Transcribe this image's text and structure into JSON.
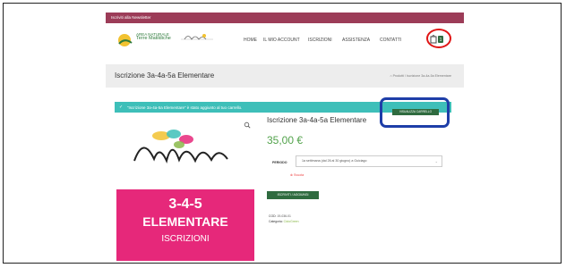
{
  "topbar": {
    "text": "Iscriviti alla Newsletter"
  },
  "header": {
    "logo_text_line1": "AREA NATURALE",
    "logo_text_line2": "Terre Matildiche",
    "logo2_alt": "ciclgreen logo",
    "nav": [
      "HOME",
      "IL MIO ACCOUNT",
      "ISCRIZIONI",
      "ASSISTENZA",
      "CONTATTI"
    ],
    "cart_count": "1"
  },
  "page": {
    "title": "Iscrizione 3a-4a-5a Elementare",
    "breadcrumb": "Prodotti  /  Iscrizione 3a-4a-5a Elementare"
  },
  "notice": {
    "check": "✓",
    "message": "“Iscrizione 3a-4a-5a Elementare” è stato aggiunto al tuo carrello.",
    "view_cart": "VISUALIZZA CARRELLO"
  },
  "product": {
    "image_text_1": "3-4-5",
    "image_text_2": "ELEMENTARE",
    "image_text_3": "ISCRIZIONI",
    "title": "Iscrizione 3a-4a-5a Elementare",
    "price": "35,00 €",
    "period_label": "PERIODO",
    "period_value": "1a settimana (dal 26 al 30 giugno) a Guiciago",
    "reset": "Svuota",
    "add_to_cart": "ISCRIVITI / AGGIUNGI",
    "sku_label": "COD:",
    "sku_value": "19-036-01",
    "category_label": "Categoria:",
    "category_value": "CicloGreen"
  },
  "colors": {
    "topbar": "#9c3c58",
    "notice": "#3ebfb9",
    "button": "#2f6b3f",
    "price": "#53a34c",
    "banner": "#e6287a",
    "annotation_red": "#e01515",
    "annotation_blue": "#1e3ea8"
  }
}
